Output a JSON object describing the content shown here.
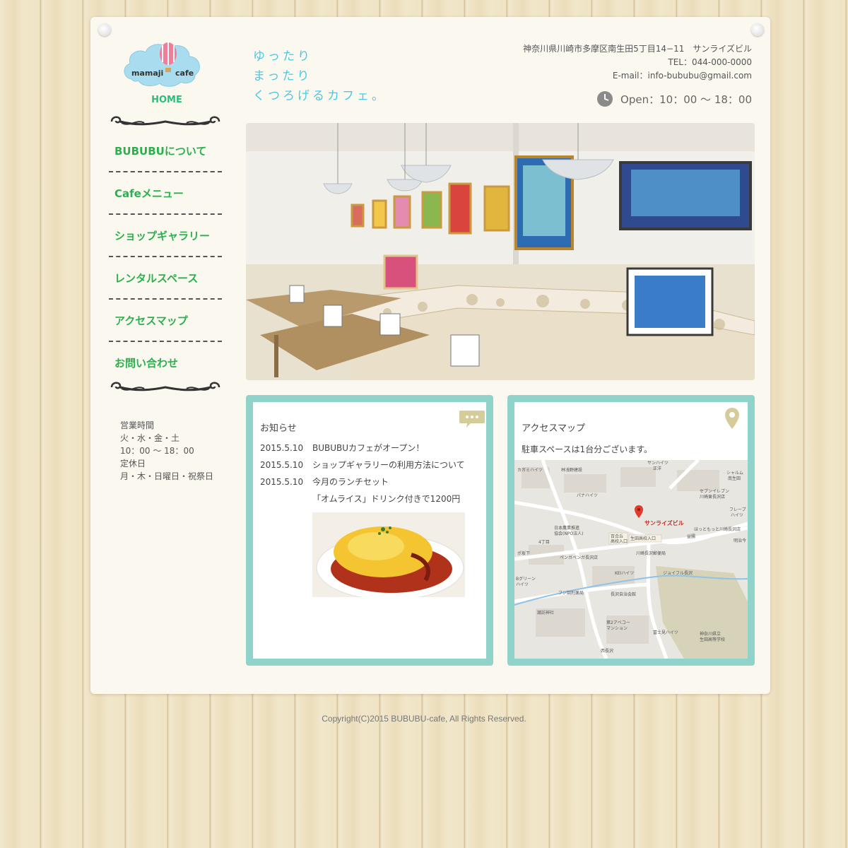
{
  "logo": {
    "text_left": "mamaji",
    "text_right": "cafe"
  },
  "home_label": "HOME",
  "nav": [
    {
      "label": "BUBUBUについて"
    },
    {
      "label": "Cafeメニュー"
    },
    {
      "label": "ショップギャラリー"
    },
    {
      "label": "レンタルスペース"
    },
    {
      "label": "アクセスマップ"
    },
    {
      "label": "お問い合わせ"
    }
  ],
  "hours": {
    "title": "営業時間",
    "days": "火・水・金・土",
    "time": "10：00 〜 18：00",
    "closed_title": "定休日",
    "closed_days": "月・木・日曜日・祝祭日"
  },
  "tagline": [
    "ゆったり",
    "まったり",
    "くつろげるカフェ。"
  ],
  "contact": {
    "address": "神奈川県川崎市多摩区南生田5丁目14−11　サンライズビル",
    "tel": "TEL：044-000-0000",
    "email": "E-mail：info-bububu@gmail.com",
    "open": "Open：10：00 〜 18：00"
  },
  "news": {
    "title": "お知らせ",
    "items": [
      {
        "date": "2015.5.10",
        "text": "BUBUBUカフェがオープン！"
      },
      {
        "date": "2015.5.10",
        "text": "ショップギャラリーの利用方法について"
      },
      {
        "date": "2015.5.10",
        "text": "今月のランチセット"
      },
      {
        "date": "",
        "text": "「オムライス」ドリンク付きで1200円"
      }
    ]
  },
  "access": {
    "title": "アクセスマップ",
    "note": "駐車スペースは1台分ございます。",
    "map_marker": "サンライズビル",
    "map_labels": [
      "カガミハイツ",
      "林浅野建設",
      "サンハイツ",
      "正洋",
      "シャルム",
      "南生田",
      "セブンイレブン",
      "川崎東長沢店",
      "パナハイツ",
      "フレーブ",
      "ハイツ",
      "日本農業推進",
      "協会(NPO法人)",
      "百合丘",
      "高校入口",
      "生田高校入口",
      "ほっともっと川崎長沢店",
      "益腸",
      "明治今",
      "4丁目",
      "ポ坂下",
      "ペンガペンガ長沢店",
      "川崎長沢郵便局",
      "Bグリーン",
      "ハイツ",
      "KEIハイツ",
      "ジョイフル長沢",
      "フジ調剤薬局",
      "長沢自治会館",
      "諏訪神社",
      "第2アベコー",
      "マンション",
      "富士見ハイツ",
      "神奈川県立",
      "生田高等学校",
      "西長沢"
    ]
  },
  "footer": "Copyright(C)2015 BUBUBU-cafe, All Rights Reserved."
}
